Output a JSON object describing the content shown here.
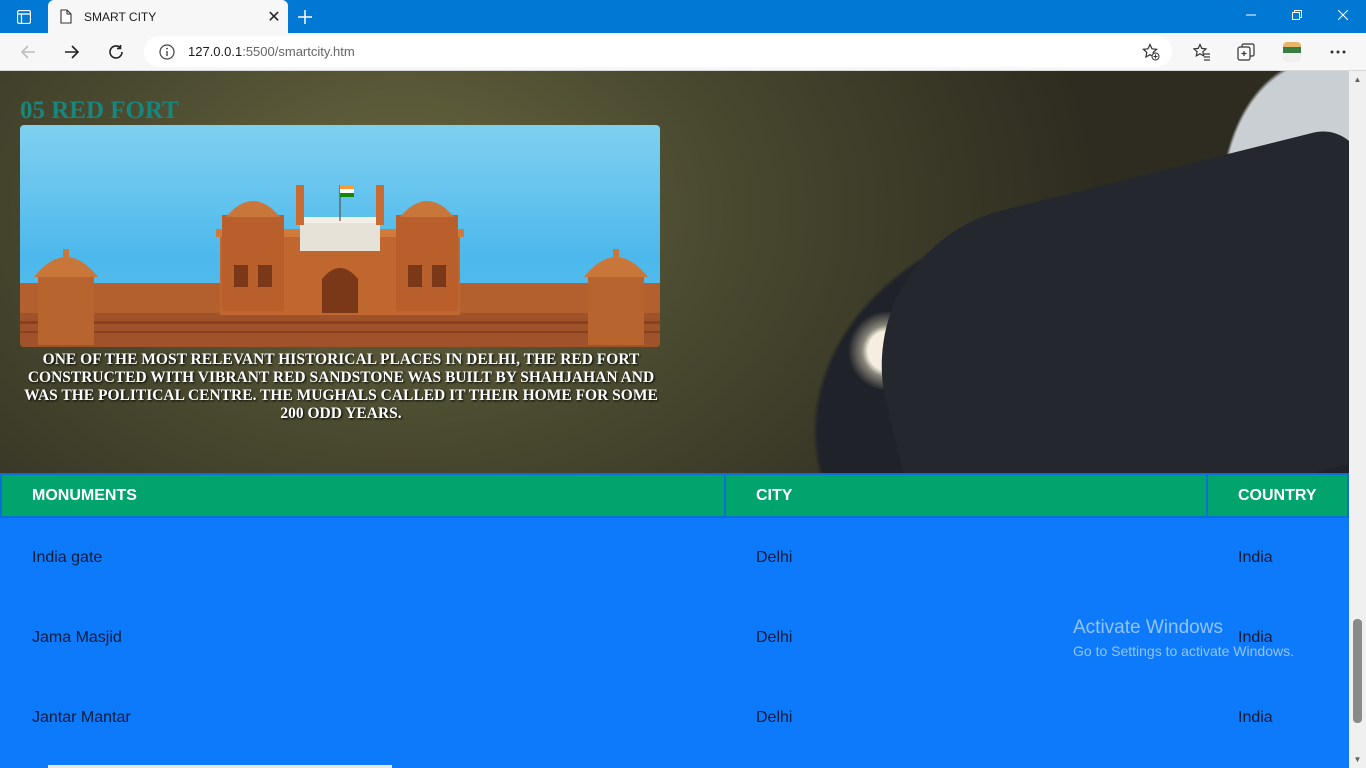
{
  "browser": {
    "tab_title": "SMART CITY",
    "url_host": "127.0.0.1",
    "url_rest": ":5500/smartcity.htm",
    "icons": [
      "tab-actions-icon",
      "page-icon",
      "close-icon",
      "plus-icon",
      "minimize-icon",
      "restore-icon",
      "close-window-icon",
      "back-arrow-icon",
      "forward-arrow-icon",
      "reload-icon",
      "info-icon",
      "add-favorite-icon",
      "favorites-icon",
      "collections-icon",
      "profile-avatar",
      "more-icon"
    ]
  },
  "section": {
    "title": "05 RED FORT",
    "image_alt": "Red Fort",
    "description": "ONE OF THE MOST RELEVANT HISTORICAL PLACES IN DELHI, THE RED FORT CONSTRUCTED WITH VIBRANT RED SANDSTONE WAS BUILT BY SHAHJAHAN AND WAS THE POLITICAL CENTRE. THE MUGHALS CALLED IT THEIR HOME FOR SOME 200 ODD YEARS."
  },
  "table": {
    "headers": [
      "MONUMENTS",
      "CITY",
      "COUNTRY"
    ],
    "rows": [
      [
        "India gate",
        "Delhi",
        "India"
      ],
      [
        "Jama Masjid",
        "Delhi",
        "India"
      ],
      [
        "Jantar Mantar",
        "Delhi",
        "India"
      ]
    ]
  },
  "watermark": {
    "title": "Activate Windows",
    "subtitle": "Go to Settings to activate Windows."
  },
  "colors": {
    "titlebar": "#0078d4",
    "section_title": "#17867c",
    "table_header": "#00a46c",
    "table_body": "#0d7afb"
  }
}
